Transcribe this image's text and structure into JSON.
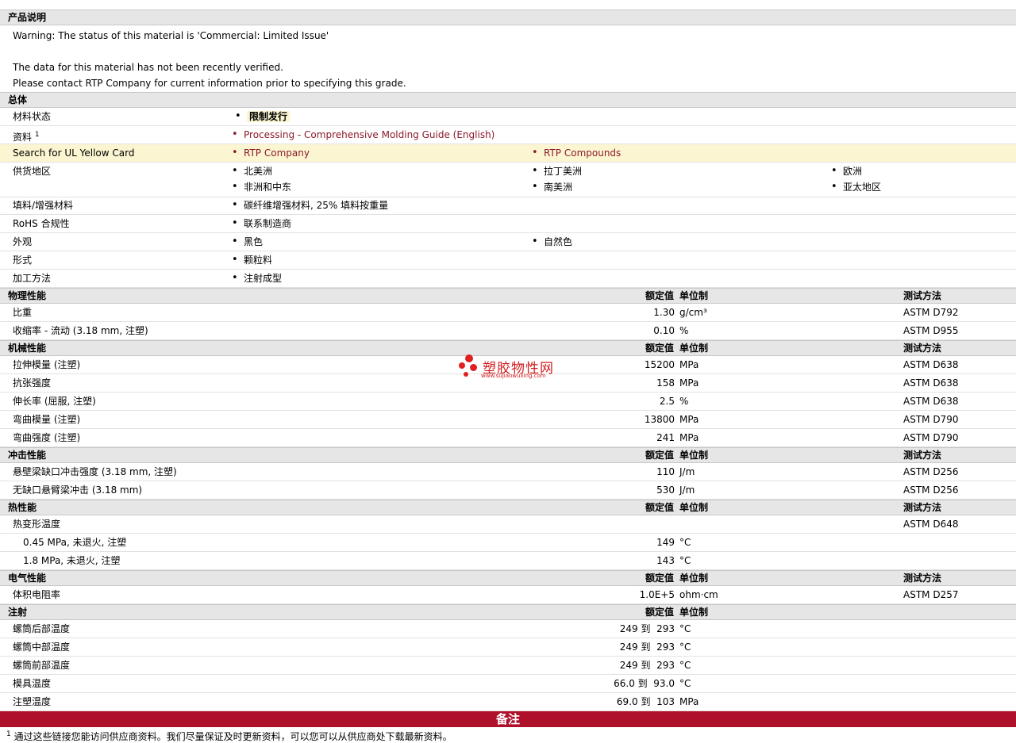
{
  "product_desc": {
    "title": "产品说明",
    "lines": [
      "Warning: The status of this material is 'Commercial: Limited Issue'",
      "The data for this material has not been recently verified.",
      "Please contact RTP Company for current information prior to specifying this grade."
    ]
  },
  "general": {
    "title": "总体",
    "material_status_label": "材料状态",
    "material_status_value": "限制发行",
    "docs_label": "资料",
    "docs_sup": "1",
    "docs_link": "Processing - Comprehensive Molding Guide (English)",
    "ul_label": "Search for UL Yellow Card",
    "ul_links": [
      "RTP Company",
      "RTP Compounds"
    ],
    "supply_label": "供货地区",
    "supply_regions": [
      "北美洲",
      "拉丁美洲",
      "欧洲",
      "非洲和中东",
      "南美洲",
      "亚太地区"
    ],
    "filler_label": "填料/增强材料",
    "filler_value": "碳纤维增强材料, 25% 填料按重量",
    "rohs_label": "RoHS 合规性",
    "rohs_value": "联系制造商",
    "appearance_label": "外观",
    "appearance_values": [
      "黑色",
      "自然色"
    ],
    "form_label": "形式",
    "form_value": "颗粒料",
    "process_label": "加工方法",
    "process_value": "注射成型"
  },
  "columns": {
    "nominal": "额定值",
    "unit": "单位制",
    "test": "测试方法"
  },
  "sections": {
    "physical": {
      "title": "物理性能",
      "rows": [
        {
          "label": "比重",
          "value": "1.30",
          "unit": "g/cm³",
          "test": "ASTM D792"
        },
        {
          "label": "收缩率 - 流动 (3.18 mm, 注塑)",
          "value": "0.10",
          "unit": "%",
          "test": "ASTM D955"
        }
      ]
    },
    "mechanical": {
      "title": "机械性能",
      "rows": [
        {
          "label": "拉伸模量 (注塑)",
          "value": "15200",
          "unit": "MPa",
          "test": "ASTM D638"
        },
        {
          "label": "抗张强度",
          "value": "158",
          "unit": "MPa",
          "test": "ASTM D638"
        },
        {
          "label": "伸长率 (屈服, 注塑)",
          "value": "2.5",
          "unit": "%",
          "test": "ASTM D638"
        },
        {
          "label": "弯曲模量 (注塑)",
          "value": "13800",
          "unit": "MPa",
          "test": "ASTM D790"
        },
        {
          "label": "弯曲强度 (注塑)",
          "value": "241",
          "unit": "MPa",
          "test": "ASTM D790"
        }
      ]
    },
    "impact": {
      "title": "冲击性能",
      "rows": [
        {
          "label": "悬壁梁缺口冲击强度 (3.18 mm, 注塑)",
          "value": "110",
          "unit": "J/m",
          "test": "ASTM D256"
        },
        {
          "label": "无缺口悬臂梁冲击 (3.18 mm)",
          "value": "530",
          "unit": "J/m",
          "test": "ASTM D256"
        }
      ]
    },
    "thermal": {
      "title": "热性能",
      "rows": [
        {
          "label": "热变形温度",
          "value": "",
          "unit": "",
          "test": "ASTM D648"
        },
        {
          "label": "0.45 MPa, 未退火, 注塑",
          "value": "149",
          "unit": "°C",
          "test": ""
        },
        {
          "label": "1.8 MPa, 未退火, 注塑",
          "value": "143",
          "unit": "°C",
          "test": ""
        }
      ]
    },
    "electrical": {
      "title": "电气性能",
      "rows": [
        {
          "label": "体积电阻率",
          "value": "1.0E+5",
          "unit": "ohm·cm",
          "test": "ASTM D257"
        }
      ]
    },
    "injection": {
      "title": "注射",
      "rows": [
        {
          "label": "螺筒后部温度",
          "value": "249 到  293",
          "unit": "°C"
        },
        {
          "label": "螺筒中部温度",
          "value": "249 到  293",
          "unit": "°C"
        },
        {
          "label": "螺筒前部温度",
          "value": "249 到  293",
          "unit": "°C"
        },
        {
          "label": "模具温度",
          "value": "66.0 到  93.0",
          "unit": "°C"
        },
        {
          "label": "注塑温度",
          "value": "69.0 到  103",
          "unit": "MPa"
        }
      ]
    }
  },
  "notes": {
    "title": "备注",
    "footnote_num": "1",
    "footnote_text": "通过这些链接您能访问供应商资料。我们尽量保证及时更新资料，可以您可以从供应商处下载最新资料。"
  },
  "watermark": {
    "name": "塑胶物性网",
    "url": "www.sujiaowuxing.com"
  }
}
